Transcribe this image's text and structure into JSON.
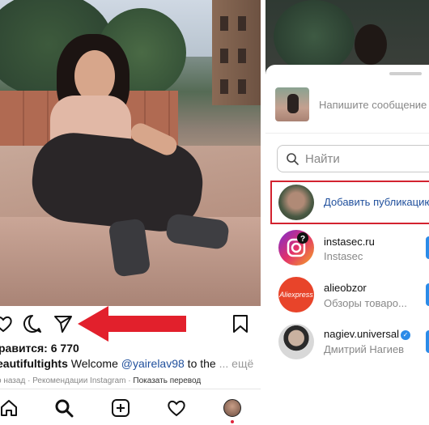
{
  "post": {
    "likes": "равится: 6 770",
    "caption_user": "eautifultights",
    "caption_text_1": " Welcome ",
    "caption_mention": "@yairelav98",
    "caption_text_2": " to the ",
    "caption_more": "... ещё",
    "meta_text": "о назад · Рекомендации Instagram · ",
    "meta_translate": "Показать перевод"
  },
  "share": {
    "message_placeholder": "Напишите сообщение",
    "search_placeholder": "Найти",
    "add_publication": "Добавить публикацию",
    "contacts": [
      {
        "name": "instasec.ru",
        "subtitle": "Instasec"
      },
      {
        "name": "alieobzor",
        "subtitle": "Обзоры товаро..."
      },
      {
        "name": "nagiev.universal",
        "subtitle": "Дмитрий Нагиев",
        "verified": true
      }
    ],
    "aliexpress_logo": "Aliexpress"
  },
  "colors": {
    "accent_blue": "#1f4f9c",
    "highlight_red": "#d3222f",
    "arrow_red": "#e2202c"
  }
}
